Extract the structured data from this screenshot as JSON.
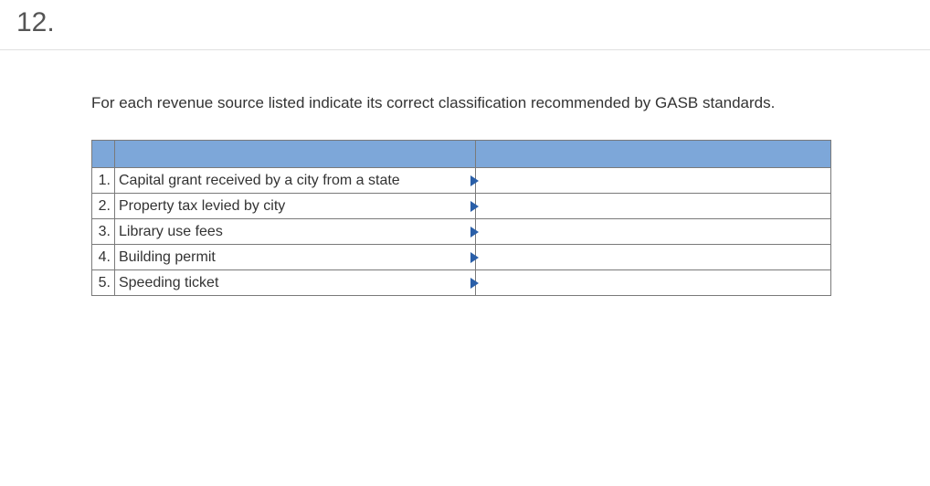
{
  "question_number": "12.",
  "instruction": "For each revenue source listed indicate its correct classification recommended by GASB standards.",
  "rows": [
    {
      "num": "1.",
      "desc": "Capital grant received by a city from a state"
    },
    {
      "num": "2.",
      "desc": "Property tax levied by city"
    },
    {
      "num": "3.",
      "desc": "Library use fees"
    },
    {
      "num": "4.",
      "desc": "Building permit"
    },
    {
      "num": "5.",
      "desc": "Speeding ticket"
    }
  ]
}
